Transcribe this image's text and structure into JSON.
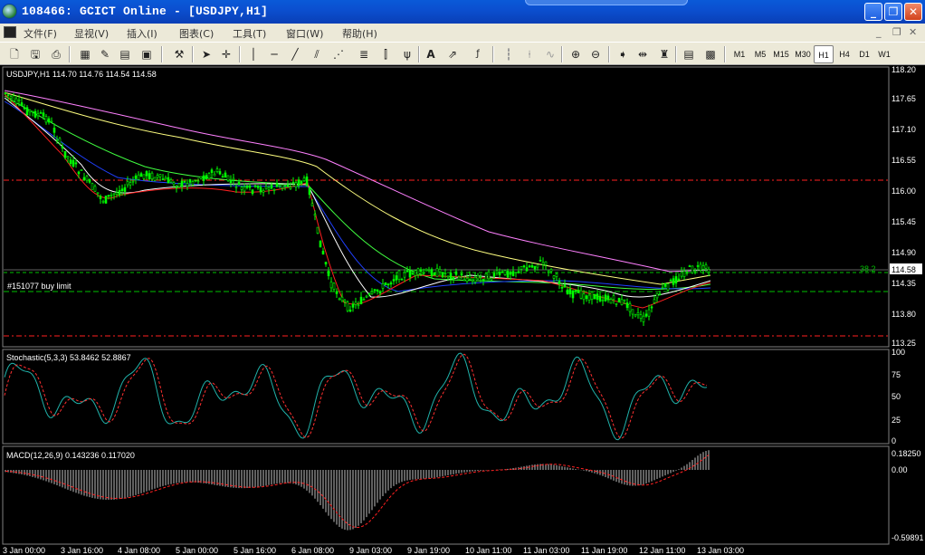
{
  "window": {
    "title": "108466: GCICT Online - [USDJPY,H1]",
    "buttons": {
      "minimize": "_",
      "restore": "❐",
      "close": "✕"
    }
  },
  "menu": {
    "items": [
      "文件(F)",
      "显视(V)",
      "插入(I)",
      "图表(C)",
      "工具(T)",
      "窗口(W)",
      "帮助(H)"
    ],
    "right_controls": [
      "_",
      "❐",
      "✕"
    ]
  },
  "toolbar": {
    "timeframes": [
      "M1",
      "M5",
      "M15",
      "M30",
      "H1",
      "H4",
      "D1",
      "W1"
    ],
    "active_timeframe": "H1"
  },
  "chart": {
    "symbol_header": "USDJPY,H1  114.70 114.76 114.54 114.58",
    "order_label": "#151077 buy limit",
    "fib_label": "38.2",
    "price_box": "114.58",
    "price_scale": [
      "118.20",
      "117.65",
      "117.10",
      "116.55",
      "116.00",
      "115.45",
      "114.90",
      "114.35",
      "113.80",
      "113.25"
    ],
    "stochastic": {
      "header": "Stochastic(5,3,3)  53.8462  52.8867",
      "scale": [
        "100",
        "75",
        "50",
        "25",
        "0"
      ],
      "main": 53.8462,
      "signal": 52.8867
    },
    "macd": {
      "header": "MACD(12,26,9)   0.143236  0.117020",
      "scale": [
        "0.18250",
        "0.00",
        "-0.59891"
      ],
      "main": 0.143236,
      "signal": 0.11702
    },
    "time_axis": [
      "3 Jan 00:00",
      "3 Jan 16:00",
      "4 Jan 08:00",
      "5 Jan 00:00",
      "5 Jan 16:00",
      "6 Jan 08:00",
      "9 Jan 03:00",
      "9 Jan 19:00",
      "10 Jan 11:00",
      "11 Jan 03:00",
      "11 Jan 19:00",
      "12 Jan 11:00",
      "13 Jan 03:00"
    ],
    "colors": {
      "candle": "#00ff00",
      "red_level": "#ff2020",
      "green_level": "#00c000",
      "ma_pink": "#ff80ff",
      "ma_yellow": "#ffff80",
      "ma_green": "#40ff40",
      "ma_blue": "#2040ff",
      "ma_red": "#ff2020",
      "ma_white": "#ffffff",
      "stoch_main": "#20b2aa",
      "stoch_signal": "#ff3030"
    }
  }
}
